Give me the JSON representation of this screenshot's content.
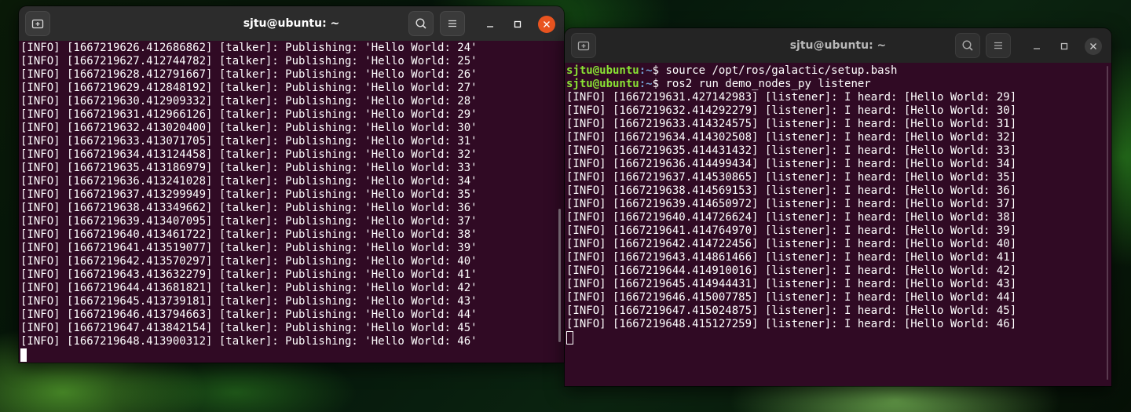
{
  "left_window": {
    "title": "sjtu@ubuntu: ~",
    "lines": [
      "[INFO] [1667219626.412686862] [talker]: Publishing: 'Hello World: 24'",
      "[INFO] [1667219627.412744782] [talker]: Publishing: 'Hello World: 25'",
      "[INFO] [1667219628.412791667] [talker]: Publishing: 'Hello World: 26'",
      "[INFO] [1667219629.412848192] [talker]: Publishing: 'Hello World: 27'",
      "[INFO] [1667219630.412909332] [talker]: Publishing: 'Hello World: 28'",
      "[INFO] [1667219631.412966126] [talker]: Publishing: 'Hello World: 29'",
      "[INFO] [1667219632.413020400] [talker]: Publishing: 'Hello World: 30'",
      "[INFO] [1667219633.413071705] [talker]: Publishing: 'Hello World: 31'",
      "[INFO] [1667219634.413124458] [talker]: Publishing: 'Hello World: 32'",
      "[INFO] [1667219635.413186979] [talker]: Publishing: 'Hello World: 33'",
      "[INFO] [1667219636.413241028] [talker]: Publishing: 'Hello World: 34'",
      "[INFO] [1667219637.413299949] [talker]: Publishing: 'Hello World: 35'",
      "[INFO] [1667219638.413349662] [talker]: Publishing: 'Hello World: 36'",
      "[INFO] [1667219639.413407095] [talker]: Publishing: 'Hello World: 37'",
      "[INFO] [1667219640.413461722] [talker]: Publishing: 'Hello World: 38'",
      "[INFO] [1667219641.413519077] [talker]: Publishing: 'Hello World: 39'",
      "[INFO] [1667219642.413570297] [talker]: Publishing: 'Hello World: 40'",
      "[INFO] [1667219643.413632279] [talker]: Publishing: 'Hello World: 41'",
      "[INFO] [1667219644.413681821] [talker]: Publishing: 'Hello World: 42'",
      "[INFO] [1667219645.413739181] [talker]: Publishing: 'Hello World: 43'",
      "[INFO] [1667219646.413794663] [talker]: Publishing: 'Hello World: 44'",
      "[INFO] [1667219647.413842154] [talker]: Publishing: 'Hello World: 45'",
      "[INFO] [1667219648.413900312] [talker]: Publishing: 'Hello World: 46'"
    ]
  },
  "right_window": {
    "title": "sjtu@ubuntu: ~",
    "commands": [
      {
        "user": "sjtu@ubuntu",
        "path": ":~",
        "prompt": "$",
        "command": " source /opt/ros/galactic/setup.bash"
      },
      {
        "user": "sjtu@ubuntu",
        "path": ":~",
        "prompt": "$",
        "command": " ros2 run demo_nodes_py listener"
      }
    ],
    "lines": [
      "[INFO] [1667219631.427142983] [listener]: I heard: [Hello World: 29]",
      "[INFO] [1667219632.414292279] [listener]: I heard: [Hello World: 30]",
      "[INFO] [1667219633.414324575] [listener]: I heard: [Hello World: 31]",
      "[INFO] [1667219634.414302508] [listener]: I heard: [Hello World: 32]",
      "[INFO] [1667219635.414431432] [listener]: I heard: [Hello World: 33]",
      "[INFO] [1667219636.414499434] [listener]: I heard: [Hello World: 34]",
      "[INFO] [1667219637.414530865] [listener]: I heard: [Hello World: 35]",
      "[INFO] [1667219638.414569153] [listener]: I heard: [Hello World: 36]",
      "[INFO] [1667219639.414650972] [listener]: I heard: [Hello World: 37]",
      "[INFO] [1667219640.414726624] [listener]: I heard: [Hello World: 38]",
      "[INFO] [1667219641.414764970] [listener]: I heard: [Hello World: 39]",
      "[INFO] [1667219642.414722456] [listener]: I heard: [Hello World: 40]",
      "[INFO] [1667219643.414861466] [listener]: I heard: [Hello World: 41]",
      "[INFO] [1667219644.414910016] [listener]: I heard: [Hello World: 42]",
      "[INFO] [1667219645.414944431] [listener]: I heard: [Hello World: 43]",
      "[INFO] [1667219646.415007785] [listener]: I heard: [Hello World: 44]",
      "[INFO] [1667219647.415024875] [listener]: I heard: [Hello World: 45]",
      "[INFO] [1667219648.415127259] [listener]: I heard: [Hello World: 46]"
    ]
  },
  "icons": {
    "new_tab": "new-tab-icon",
    "search": "search-icon",
    "menu": "hamburger-menu-icon",
    "minimize": "minimize-icon",
    "maximize": "maximize-icon",
    "close": "close-icon"
  },
  "colors": {
    "terminal_bg": "#300a24",
    "titlebar_active": "#2c2c2c",
    "titlebar_inactive": "#242424",
    "close_active": "#e95420",
    "prompt_user": "#8ae234",
    "prompt_path": "#729fcf"
  }
}
